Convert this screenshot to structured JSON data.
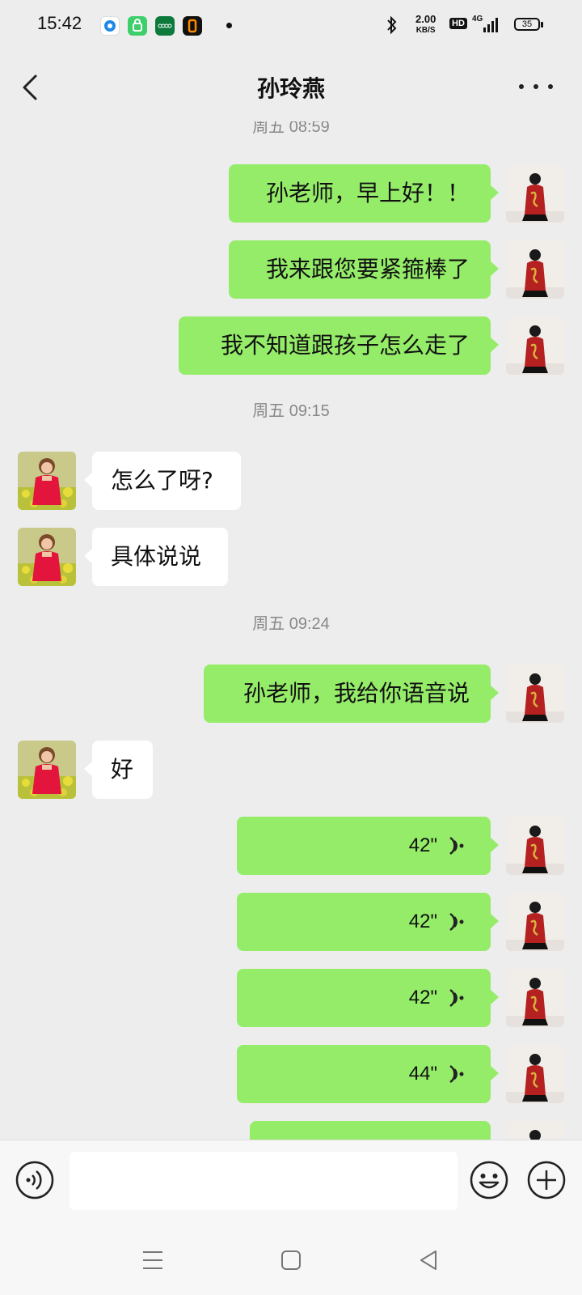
{
  "status_bar": {
    "time": "15:42",
    "net_speed_value": "2.00",
    "net_speed_unit": "KB/S",
    "hd_badge": "HD",
    "network_type": "4G",
    "battery": "35"
  },
  "header": {
    "title": "孙玲燕"
  },
  "messages": {
    "ts1": "周五 08:59",
    "m1": "孙老师，早上好！！",
    "m2": "我来跟您要紧箍棒了",
    "m3": "我不知道跟孩子怎么走了",
    "ts2": "周五 09:15",
    "m4": "怎么了呀?",
    "m5": "具体说说",
    "ts3": "周五 09:24",
    "m6": "孙老师，我给你语音说",
    "m7": "好",
    "v1": "42\"",
    "v2": "42\"",
    "v3": "42\"",
    "v4": "44\""
  },
  "icons": {
    "back": "chevron-left-icon",
    "more": "more-dots-icon",
    "voice_mode": "voice-mode-icon",
    "emoji": "emoji-icon",
    "plus": "plus-icon",
    "voice_wave": "voice-wave-icon"
  },
  "colors": {
    "my_bubble": "#95ec69",
    "other_bubble": "#ffffff",
    "background": "#ededed"
  }
}
